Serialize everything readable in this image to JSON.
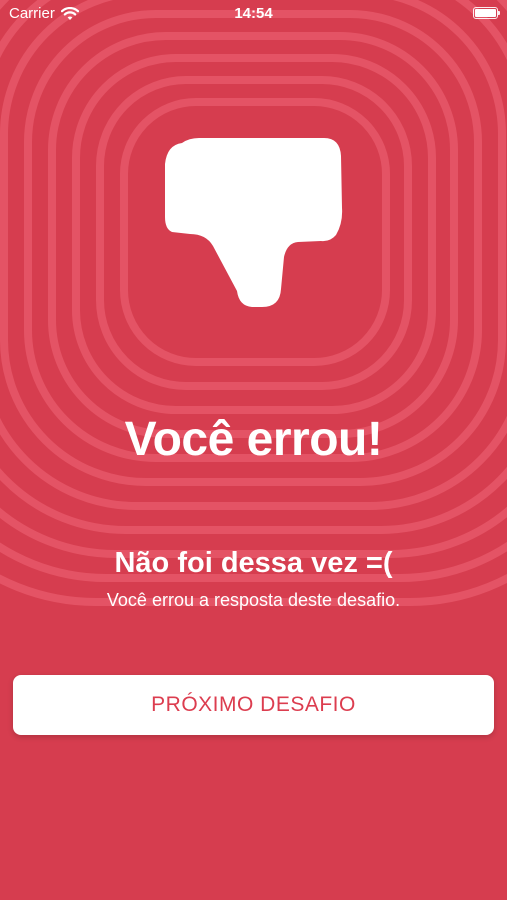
{
  "status_bar": {
    "carrier": "Carrier",
    "time": "14:54",
    "wifi_icon": "wifi-icon",
    "battery_icon": "battery-icon"
  },
  "result": {
    "icon": "thumbs-down-icon",
    "title": "Você errou!",
    "subtitle": "Não foi dessa vez =(",
    "description": "Você errou a resposta deste desafio."
  },
  "actions": {
    "next_button": "PRÓXIMO DESAFIO"
  },
  "colors": {
    "background": "#d63d4f",
    "ring": "#e8596a",
    "button_text": "#dc3d4f",
    "button_background": "#ffffff"
  }
}
